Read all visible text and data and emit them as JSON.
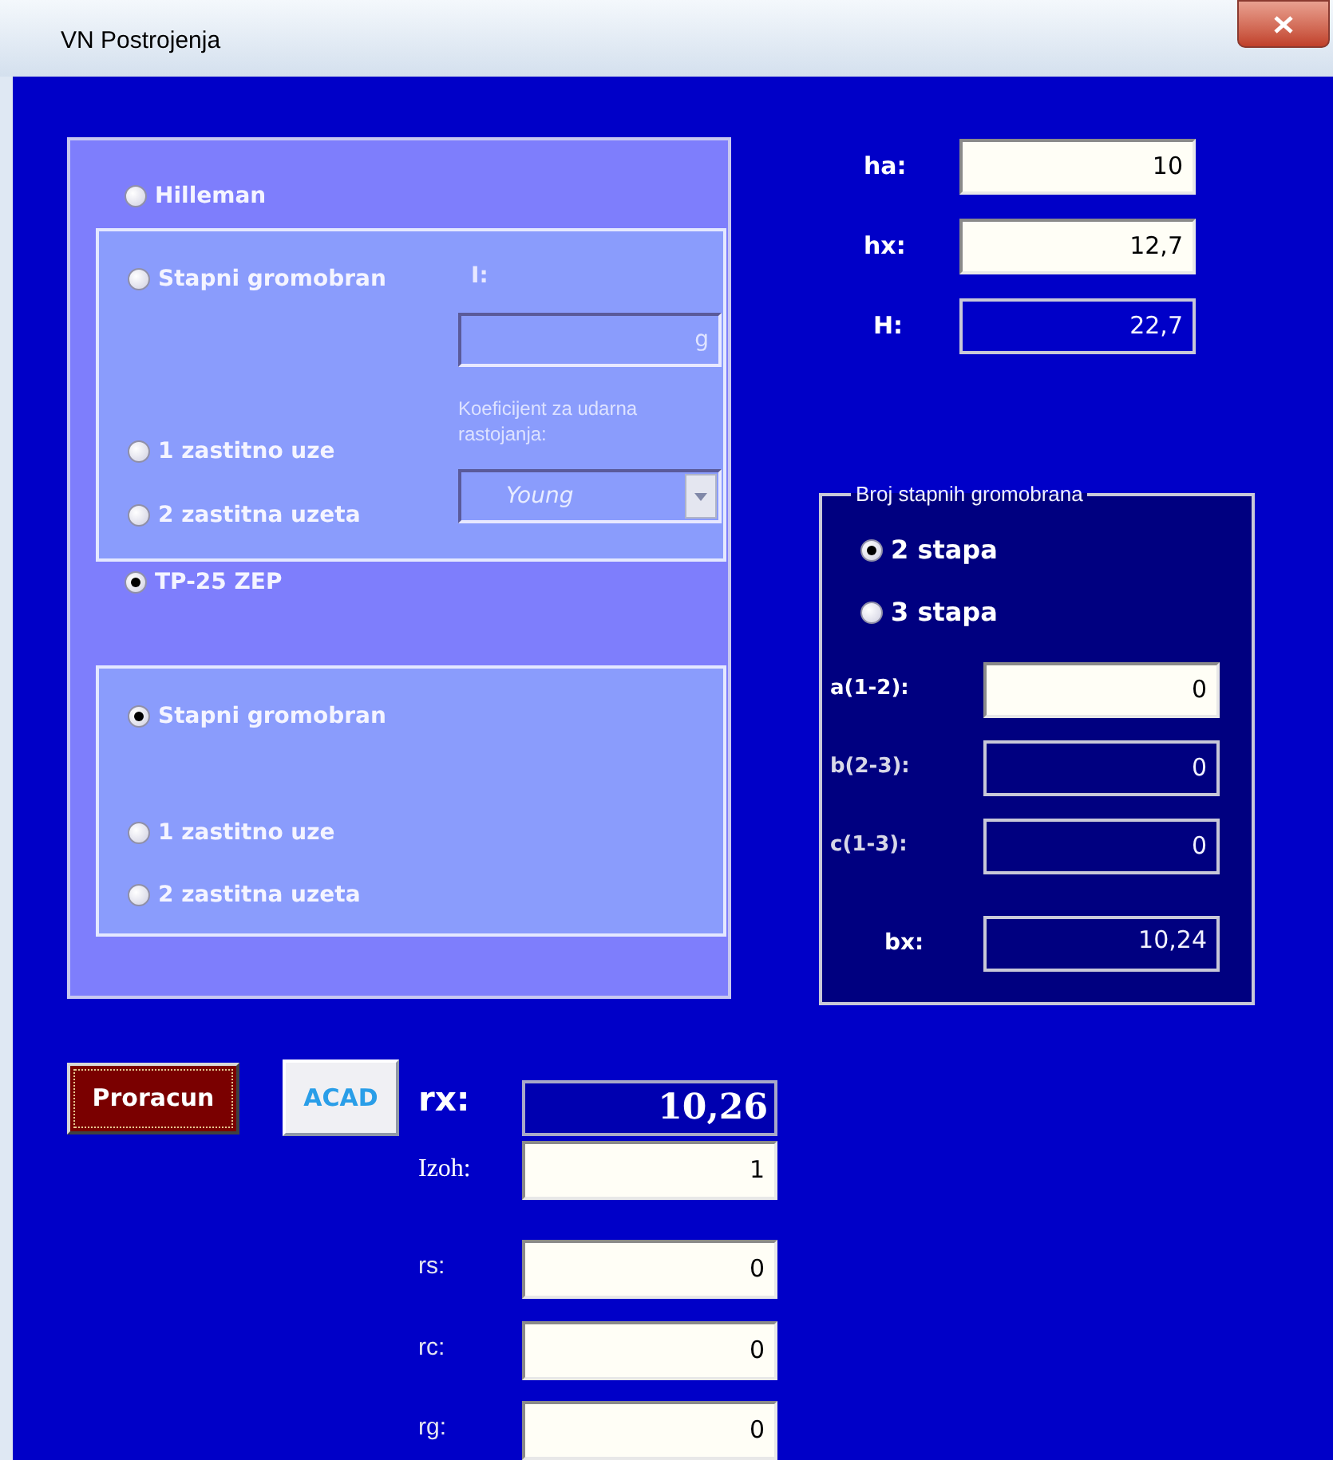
{
  "window": {
    "title": "VN Postrojenja"
  },
  "methods": [
    {
      "label": "Hilleman",
      "selected": false,
      "types": [
        {
          "label": "Stapni gromobran",
          "selected": false
        },
        {
          "label": "1 zastitno uze",
          "selected": false
        },
        {
          "label": "2 zastitna uzeta",
          "selected": false
        }
      ],
      "current_label": "I:",
      "current_field": {
        "value": "g",
        "disabled": true
      },
      "coefficient_label": "Koeficijent za udarna rastojanja:",
      "coefficient_dropdown": {
        "value": "Young",
        "disabled": true
      }
    },
    {
      "label": "TP-25 ZEP",
      "selected": true,
      "types": [
        {
          "label": "Stapni gromobran",
          "selected": true
        },
        {
          "label": "1 zastitno uze",
          "selected": false
        },
        {
          "label": "2 zastitna uzeta",
          "selected": false
        }
      ]
    }
  ],
  "heights": [
    {
      "label": "ha:",
      "value": "10",
      "editable": true
    },
    {
      "label": "hx:",
      "value": "12,7",
      "editable": true
    },
    {
      "label": "H:",
      "value": "22,7",
      "editable": false
    }
  ],
  "rods_group": {
    "title": "Broj stapnih gromobrana",
    "options": [
      {
        "label": "2 stapa",
        "selected": true
      },
      {
        "label": "3 stapa",
        "selected": false
      }
    ],
    "distances": [
      {
        "label": "a(1-2):",
        "value": "0",
        "editable": true
      },
      {
        "label": "b(2-3):",
        "value": "0",
        "editable": false
      },
      {
        "label": "c(1-3):",
        "value": "0",
        "editable": false
      }
    ],
    "bx": {
      "label": "bx:",
      "value": "10,24"
    }
  },
  "buttons": [
    {
      "label": "Proracun",
      "kind": "primary"
    },
    {
      "label": "ACAD",
      "kind": "secondary"
    }
  ],
  "results": [
    {
      "label": "rx:",
      "value": "10,26",
      "kind": "result"
    },
    {
      "label": "Izoh:",
      "value": "1",
      "kind": "input"
    },
    {
      "label": "rs:",
      "value": "0",
      "kind": "input"
    },
    {
      "label": "rc:",
      "value": "0",
      "kind": "input"
    },
    {
      "label": "rg:",
      "value": "0",
      "kind": "input"
    }
  ]
}
